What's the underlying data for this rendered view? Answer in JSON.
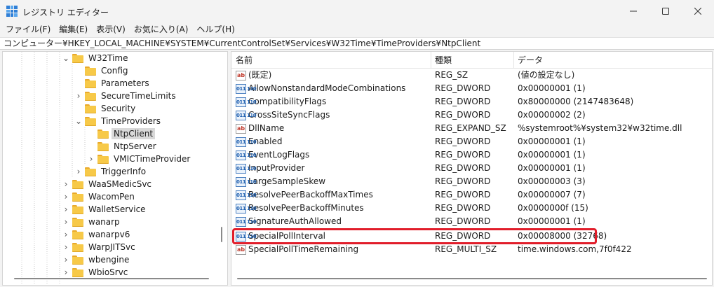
{
  "window": {
    "title": "レジストリ エディター"
  },
  "menu": [
    "ファイル(F)",
    "編集(E)",
    "表示(V)",
    "お気に入り(A)",
    "ヘルプ(H)"
  ],
  "address": "コンピューター¥HKEY_LOCAL_MACHINE¥SYSTEM¥CurrentControlSet¥Services¥W32Time¥TimeProviders¥NtpClient",
  "tree": [
    {
      "label": "W32Time",
      "chevron": "down"
    },
    {
      "label": "Config",
      "chevron": "none"
    },
    {
      "label": "Parameters",
      "chevron": "none"
    },
    {
      "label": "SecureTimeLimits",
      "chevron": "right"
    },
    {
      "label": "Security",
      "chevron": "none"
    },
    {
      "label": "TimeProviders",
      "chevron": "down"
    },
    {
      "label": "NtpClient",
      "chevron": "none",
      "selected": true
    },
    {
      "label": "NtpServer",
      "chevron": "none"
    },
    {
      "label": "VMICTimeProvider",
      "chevron": "right"
    },
    {
      "label": "TriggerInfo",
      "chevron": "right"
    },
    {
      "label": "WaaSMedicSvc",
      "chevron": "right"
    },
    {
      "label": "WacomPen",
      "chevron": "right"
    },
    {
      "label": "WalletService",
      "chevron": "right"
    },
    {
      "label": "wanarp",
      "chevron": "right"
    },
    {
      "label": "wanarpv6",
      "chevron": "right"
    },
    {
      "label": "WarpJITSvc",
      "chevron": "right"
    },
    {
      "label": "wbengine",
      "chevron": "right"
    },
    {
      "label": "WbioSrvc",
      "chevron": "right"
    }
  ],
  "list": {
    "columns": [
      "名前",
      "種類",
      "データ"
    ],
    "rows": [
      {
        "name": "(既定)",
        "type": "REG_SZ",
        "data": "(値の設定なし)",
        "icon": "string-value-icon"
      },
      {
        "name": "AllowNonstandardModeCombinations",
        "type": "REG_DWORD",
        "data": "0x00000001 (1)",
        "icon": "binary-value-icon"
      },
      {
        "name": "CompatibilityFlags",
        "type": "REG_DWORD",
        "data": "0x80000000 (2147483648)",
        "icon": "binary-value-icon"
      },
      {
        "name": "CrossSiteSyncFlags",
        "type": "REG_DWORD",
        "data": "0x00000002 (2)",
        "icon": "binary-value-icon"
      },
      {
        "name": "DllName",
        "type": "REG_EXPAND_SZ",
        "data": "%systemroot%¥system32¥w32time.dll",
        "icon": "string-value-icon"
      },
      {
        "name": "Enabled",
        "type": "REG_DWORD",
        "data": "0x00000001 (1)",
        "icon": "binary-value-icon"
      },
      {
        "name": "EventLogFlags",
        "type": "REG_DWORD",
        "data": "0x00000001 (1)",
        "icon": "binary-value-icon"
      },
      {
        "name": "InputProvider",
        "type": "REG_DWORD",
        "data": "0x00000001 (1)",
        "icon": "binary-value-icon"
      },
      {
        "name": "LargeSampleSkew",
        "type": "REG_DWORD",
        "data": "0x00000003 (3)",
        "icon": "binary-value-icon"
      },
      {
        "name": "ResolvePeerBackoffMaxTimes",
        "type": "REG_DWORD",
        "data": "0x00000007 (7)",
        "icon": "binary-value-icon"
      },
      {
        "name": "ResolvePeerBackoffMinutes",
        "type": "REG_DWORD",
        "data": "0x0000000f (15)",
        "icon": "binary-value-icon"
      },
      {
        "name": "SignatureAuthAllowed",
        "type": "REG_DWORD",
        "data": "0x00000001 (1)",
        "icon": "binary-value-icon"
      },
      {
        "name": "SpecialPollInterval",
        "type": "REG_DWORD",
        "data": "0x00008000 (32768)",
        "icon": "binary-value-icon",
        "highlighted": true
      },
      {
        "name": "SpecialPollTimeRemaining",
        "type": "REG_MULTI_SZ",
        "data": "time.windows.com,7f0f422",
        "icon": "string-value-icon"
      }
    ]
  },
  "icon_glyphs": {
    "string": "ab",
    "binary": "011 110"
  },
  "colors": {
    "highlight_border": "#e11d2a",
    "folder": "#f7c948",
    "selected_bg": "#d9d9d9"
  }
}
